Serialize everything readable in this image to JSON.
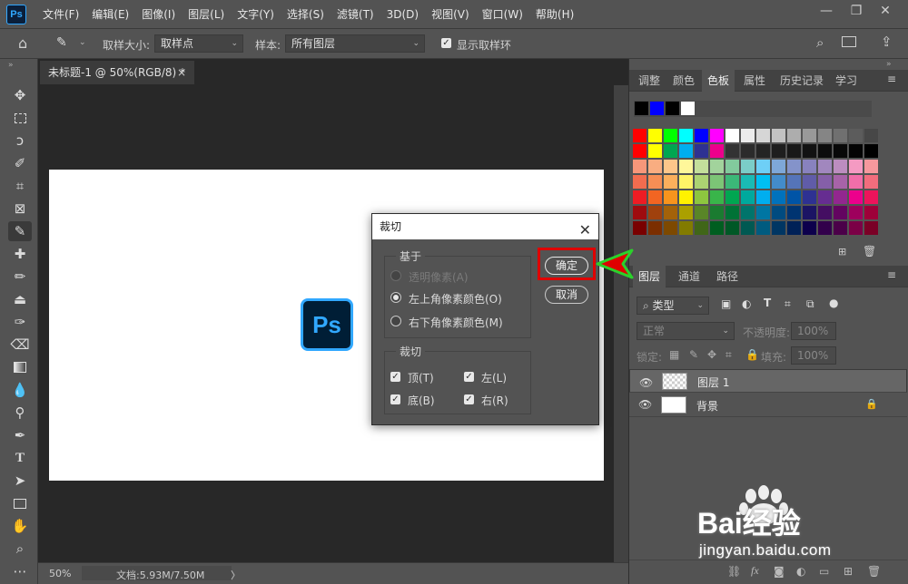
{
  "app": {
    "logo": "Ps"
  },
  "menu": [
    "文件(F)",
    "编辑(E)",
    "图像(I)",
    "图层(L)",
    "文字(Y)",
    "选择(S)",
    "滤镜(T)",
    "3D(D)",
    "视图(V)",
    "窗口(W)",
    "帮助(H)"
  ],
  "window_controls": {
    "minimize": "—",
    "restore": "❐",
    "close": "✕"
  },
  "options": {
    "sample_size_label": "取样大小:",
    "sample_size_value": "取样点",
    "sample_label": "样本:",
    "sample_value": "所有图层",
    "show_ring_label": "显示取样环",
    "show_ring_checked": true
  },
  "document": {
    "tab_title": "未标题-1 @ 50%(RGB/8) *",
    "tab_close": "×",
    "canvas_logo": "Ps",
    "zoom": "50%",
    "doc_info": "文档:5.93M/7.50M",
    "nav_arrow": "〉"
  },
  "dialog": {
    "title": "裁切",
    "close": "✕",
    "based_on_title": "基于",
    "options": [
      {
        "label": "透明像素(A)",
        "selected": false,
        "disabled": true
      },
      {
        "label": "左上角像素颜色(O)",
        "selected": true,
        "disabled": false
      },
      {
        "label": "右下角像素颜色(M)",
        "selected": false,
        "disabled": false
      }
    ],
    "trim_title": "裁切",
    "trim": {
      "top": "顶(T)",
      "left": "左(L)",
      "bottom": "底(B)",
      "right": "右(R)"
    },
    "ok": "确定",
    "cancel": "取消"
  },
  "panel_top": {
    "tabs": [
      "调整",
      "颜色",
      "色板",
      "属性",
      "历史记录",
      "学习"
    ],
    "active_tab": "色板",
    "recent_colors": [
      "#000000",
      "#0000ff",
      "#000000",
      "#ffffff"
    ]
  },
  "swatch_rows": [
    [
      "#ff0000",
      "#ffff00",
      "#00ff00",
      "#00ffff",
      "#0000ff",
      "#ff00ff",
      "#ffffff",
      "#ebebeb",
      "#d6d6d6",
      "#c2c2c2",
      "#adadad",
      "#999999",
      "#858585",
      "#707070",
      "#5c5c5c",
      "#474747"
    ],
    [
      "#ff0000",
      "#ffff00",
      "#00a651",
      "#00aeef",
      "#2e3192",
      "#ec008c",
      "#333333",
      "#2b2b2b",
      "#242424",
      "#1e1e1e",
      "#181818",
      "#121212",
      "#0c0c0c",
      "#080808",
      "#040404",
      "#000000"
    ],
    [
      "#f7977a",
      "#f9ad81",
      "#fdc68a",
      "#fff79a",
      "#c4df9b",
      "#a2d39c",
      "#82ca9d",
      "#7bcdc8",
      "#6ecff6",
      "#7ea7d8",
      "#8493ca",
      "#8882be",
      "#a187be",
      "#bc8dbf",
      "#f49ac2",
      "#f6989d"
    ],
    [
      "#f26c4f",
      "#f68e55",
      "#fbaf5c",
      "#fff467",
      "#acd372",
      "#7cc576",
      "#3bb878",
      "#1abbb4",
      "#00bff3",
      "#438ccb",
      "#5574b9",
      "#605ca8",
      "#855fa8",
      "#a763a8",
      "#f06ea9",
      "#f26d7d"
    ],
    [
      "#ed1c24",
      "#f26522",
      "#f7941d",
      "#fff200",
      "#8dc63f",
      "#39b54a",
      "#00a651",
      "#00a99d",
      "#00aeef",
      "#0072bc",
      "#0054a6",
      "#2e3192",
      "#662d91",
      "#92278f",
      "#ec008c",
      "#ed145b"
    ],
    [
      "#9e0b0f",
      "#a0410d",
      "#a36209",
      "#aba000",
      "#598527",
      "#1a7b30",
      "#007236",
      "#00746b",
      "#0076a3",
      "#004b80",
      "#003471",
      "#1b1464",
      "#440e62",
      "#630460",
      "#9e005d",
      "#9e0039"
    ],
    [
      "#790000",
      "#7b2e00",
      "#7d4900",
      "#827b00",
      "#406618",
      "#005e20",
      "#005826",
      "#005952",
      "#005b7f",
      "#003663",
      "#002157",
      "#0d004c",
      "#32004b",
      "#4b0049",
      "#7b0046",
      "#7a0026"
    ]
  ],
  "layers_panel": {
    "tabs": [
      "图层",
      "通道",
      "路径"
    ],
    "active_tab": "图层",
    "filter_label": "类型",
    "blend_mode": "正常",
    "opacity_label": "不透明度:",
    "opacity_value": "100%",
    "lock_label": "锁定:",
    "fill_label": "填充:",
    "fill_value": "100%",
    "layers": [
      {
        "name": "图层 1",
        "visible": true,
        "locked": false
      },
      {
        "name": "背景",
        "visible": true,
        "locked": true
      }
    ]
  },
  "watermark": {
    "brand": "Bai经验",
    "url": "jingyan.baidu.com"
  },
  "colors": {
    "accent": "#31a8ff",
    "highlight": "#e00000",
    "arrow_fill": "#e00000",
    "arrow_stroke": "#2bd12b"
  }
}
